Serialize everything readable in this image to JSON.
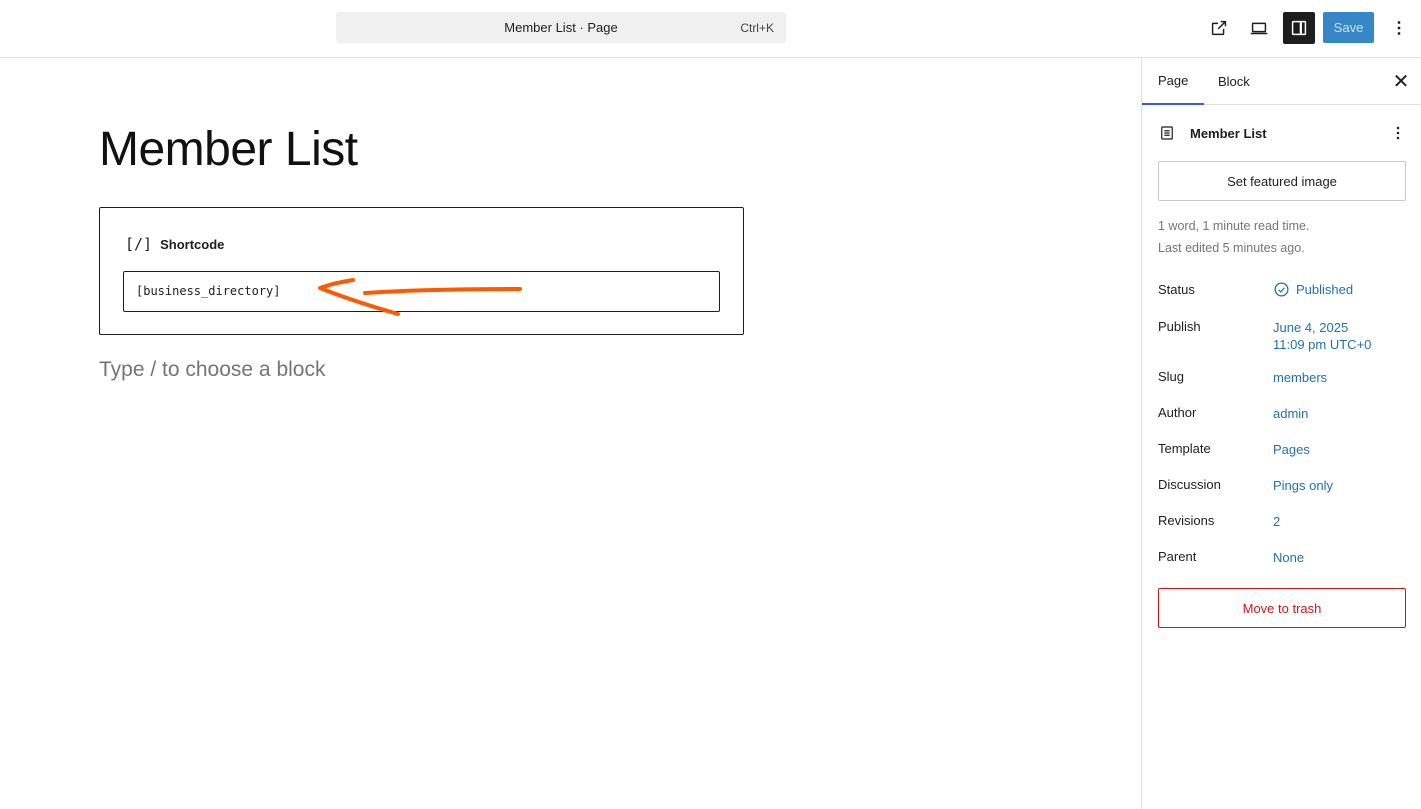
{
  "topbar": {
    "command_title": "Member List · Page",
    "command_shortcut": "Ctrl+K",
    "save_label": "Save",
    "icons": [
      "external-link-icon",
      "desktop-preview-icon",
      "sidebar-settings-icon",
      "more-options-icon"
    ]
  },
  "editor": {
    "title": "Member List",
    "shortcode_block": {
      "label": "Shortcode",
      "icon_glyph": "[/]",
      "value": "[business_directory]"
    },
    "placeholder": "Type / to choose a block",
    "annotation_color": "#ff5a00"
  },
  "sidebar": {
    "tabs": [
      {
        "label": "Page",
        "active": true
      },
      {
        "label": "Block",
        "active": false
      }
    ],
    "close_glyph": "✕",
    "document_title": "Member List",
    "featured_image_label": "Set featured image",
    "meta_line_1": "1 word, 1 minute read time.",
    "meta_line_2": "Last edited 5 minutes ago.",
    "properties": {
      "status": {
        "label": "Status",
        "value": "Published"
      },
      "publish": {
        "label": "Publish",
        "value_line1": "June 4, 2025",
        "value_line2": "11:09 pm UTC+0"
      },
      "slug": {
        "label": "Slug",
        "value": "members"
      },
      "author": {
        "label": "Author",
        "value": "admin"
      },
      "template": {
        "label": "Template",
        "value": "Pages"
      },
      "discussion": {
        "label": "Discussion",
        "value": "Pings only"
      },
      "revisions": {
        "label": "Revisions",
        "value": "2"
      },
      "parent": {
        "label": "Parent",
        "value": "None"
      }
    },
    "trash_label": "Move to trash"
  },
  "colors": {
    "accent": "#3858e9",
    "link": "#2271b1",
    "save_bg": "#3787c7",
    "danger": "#cc1818"
  }
}
